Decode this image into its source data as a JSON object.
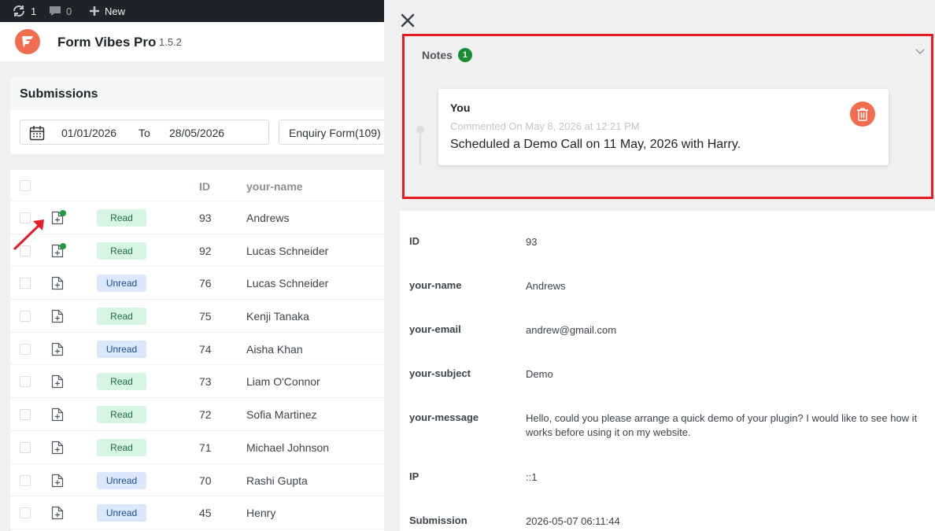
{
  "admin_bar": {
    "updates_count": "1",
    "comments_count": "0",
    "new_label": "New"
  },
  "app": {
    "title": "Form Vibes Pro",
    "version": "1.5.2"
  },
  "submissions": {
    "title": "Submissions",
    "date_from": "01/01/2026",
    "to_label": "To",
    "date_to": "28/05/2026",
    "form_select": "Enquiry Form(109)"
  },
  "table": {
    "columns": [
      "ID",
      "your-name"
    ],
    "rows": [
      {
        "status": "Read",
        "id": "93",
        "name": "Andrews",
        "has_note": true
      },
      {
        "status": "Read",
        "id": "92",
        "name": "Lucas Schneider",
        "has_note": true
      },
      {
        "status": "Unread",
        "id": "76",
        "name": "Lucas Schneider",
        "has_note": false
      },
      {
        "status": "Read",
        "id": "75",
        "name": "Kenji Tanaka",
        "has_note": false
      },
      {
        "status": "Unread",
        "id": "74",
        "name": "Aisha Khan",
        "has_note": false
      },
      {
        "status": "Read",
        "id": "73",
        "name": "Liam O'Connor",
        "has_note": false
      },
      {
        "status": "Read",
        "id": "72",
        "name": "Sofia Martinez",
        "has_note": false
      },
      {
        "status": "Read",
        "id": "71",
        "name": "Michael Johnson",
        "has_note": false
      },
      {
        "status": "Unread",
        "id": "70",
        "name": "Rashi Gupta",
        "has_note": false
      },
      {
        "status": "Unread",
        "id": "45",
        "name": "Henry",
        "has_note": false
      }
    ]
  },
  "notes": {
    "title": "Notes",
    "count": "1",
    "items": [
      {
        "author": "You",
        "meta": "Commented On May 8, 2026 at 12:21 PM",
        "text": "Scheduled a Demo Call on 11 May, 2026 with Harry."
      }
    ]
  },
  "details": [
    {
      "label": "ID",
      "value": "93"
    },
    {
      "label": "your-name",
      "value": "Andrews"
    },
    {
      "label": "your-email",
      "value": "andrew@gmail.com"
    },
    {
      "label": "your-subject",
      "value": "Demo"
    },
    {
      "label": "your-message",
      "value": "Hello, could you please arrange a quick demo of your plugin? I would like to see how it works before using it on my website."
    },
    {
      "label": "IP",
      "value": "::1"
    },
    {
      "label": "Submission",
      "value": "2026-05-07 06:11:44"
    }
  ],
  "colors": {
    "accent": "#f26c4f",
    "highlight_border": "#e51c23",
    "read_bg": "#d7f5e3",
    "unread_bg": "#dbe8fb",
    "note_dot": "#1a9c3c"
  }
}
